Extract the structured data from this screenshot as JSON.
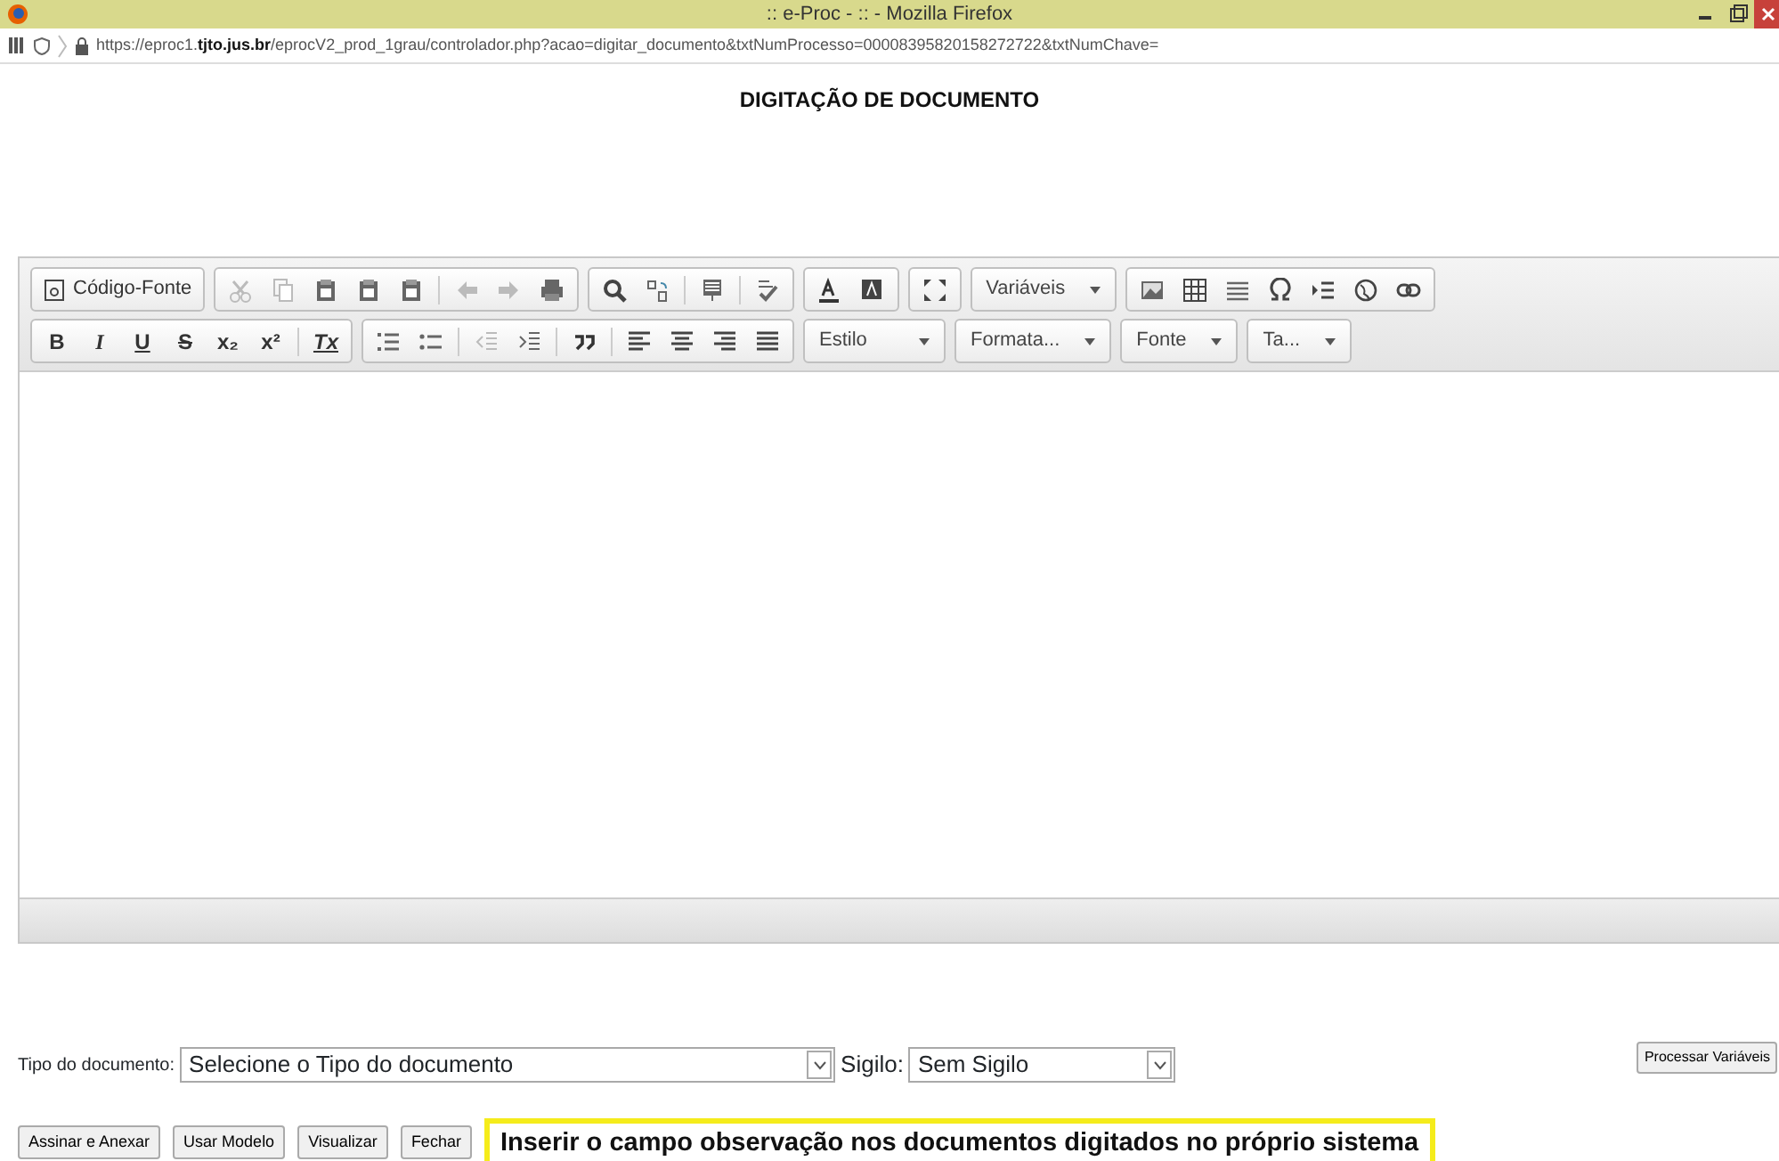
{
  "window": {
    "title": ":: e-Proc - :: - Mozilla Firefox"
  },
  "address_bar": {
    "url_prefix": "https://eproc1.",
    "url_domain": "tjto.jus.br",
    "url_rest": "/eprocV2_prod_1grau/controlador.php?acao=digitar_documento&txtNumProcesso=00008395820158272722&txtNumChave="
  },
  "heading": "DIGITAÇÃO DE DOCUMENTO",
  "editor": {
    "source_button": "Código-Fonte",
    "variables_dropdown": "Variáveis",
    "format_buttons": [
      "B",
      "I",
      "U",
      "S",
      "x₂",
      "x²",
      "Tx"
    ],
    "dropdowns": [
      {
        "label": "Estilo"
      },
      {
        "label": "Formata..."
      },
      {
        "label": "Fonte"
      },
      {
        "label": "Ta..."
      }
    ]
  },
  "process_button": "Processar Variáveis",
  "form": {
    "type_label": "Tipo do documento:",
    "type_value": "Selecione o Tipo do documento",
    "secrecy_label": "Sigilo:",
    "secrecy_value": "Sem Sigilo"
  },
  "buttons": [
    "Assinar e Anexar",
    "Usar Modelo",
    "Visualizar",
    "Fechar"
  ],
  "callout": "Inserir o campo observação nos documentos digitados no próprio sistema"
}
